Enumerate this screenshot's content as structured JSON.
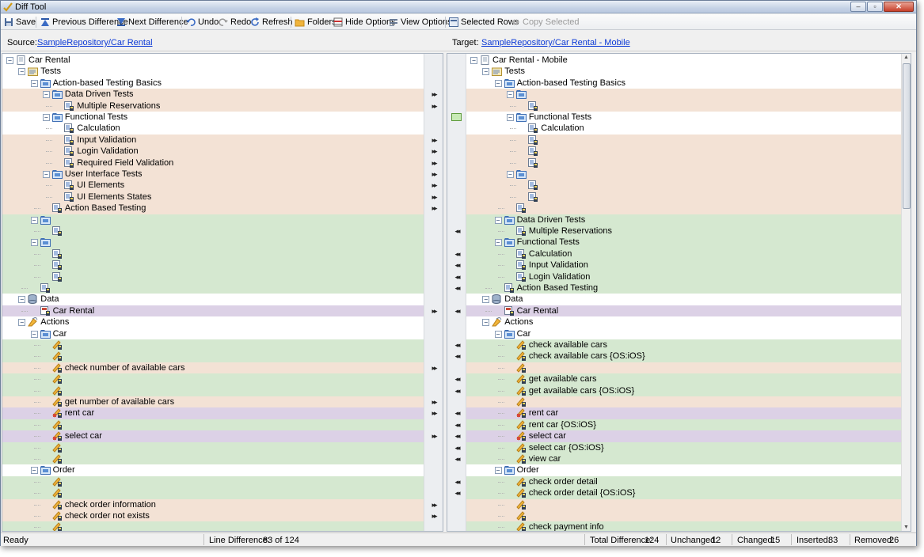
{
  "window": {
    "title": "Diff Tool",
    "controls": {
      "minimize": "–",
      "maximize": "▫",
      "close": "✕"
    }
  },
  "toolbar": {
    "save": "Save",
    "previous_difference": "Previous Difference",
    "next_difference": "Next Difference",
    "undo": "Undo",
    "redo": "Redo",
    "refresh": "Refresh",
    "folders": "Folders",
    "hide_options": "Hide Options",
    "view_options": "View Options",
    "selected_rows": "Selected Rows",
    "copy_selected": "Copy Selected"
  },
  "source": {
    "label": "Source:",
    "path": "SampleRepository/Car Rental"
  },
  "target": {
    "label": "Target:",
    "path": "SampleRepository/Car Rental - Mobile"
  },
  "icon_legend": {
    "project": "document-icon",
    "tests": "tests-folder-icon",
    "folder": "folder-icon",
    "module": "test-module-icon",
    "data": "database-icon",
    "dataset": "dataset-icon",
    "actions": "actions-icon",
    "action": "action-icon",
    "action_lib": "action-library-icon"
  },
  "colors": {
    "changed": "#f3e2d5",
    "inserted": "#d5e8d0",
    "modified": "#dcd1e6",
    "link": "#0d3ad6"
  },
  "left_rows": [
    {
      "label": "Car Rental",
      "icon": "project",
      "depth": 0,
      "state": "none",
      "exp": "-"
    },
    {
      "label": "Tests",
      "icon": "tests",
      "depth": 1,
      "state": "none",
      "exp": "-"
    },
    {
      "label": "Action-based Testing Basics",
      "icon": "folder",
      "depth": 2,
      "state": "none",
      "exp": "-"
    },
    {
      "label": "Data Driven Tests",
      "icon": "folder",
      "depth": 3,
      "state": "changed",
      "exp": "-",
      "arrow": "right"
    },
    {
      "label": "Multiple Reservations",
      "icon": "module",
      "depth": 4,
      "state": "changed",
      "arrow": "right"
    },
    {
      "label": "Functional Tests",
      "icon": "folder",
      "depth": 3,
      "state": "none",
      "exp": "-"
    },
    {
      "label": "Calculation",
      "icon": "module",
      "depth": 4,
      "state": "none"
    },
    {
      "label": "Input Validation",
      "icon": "module",
      "depth": 4,
      "state": "changed",
      "arrow": "right"
    },
    {
      "label": "Login Validation",
      "icon": "module",
      "depth": 4,
      "state": "changed",
      "arrow": "right"
    },
    {
      "label": "Required Field Validation",
      "icon": "module",
      "depth": 4,
      "state": "changed",
      "arrow": "right"
    },
    {
      "label": "User Interface Tests",
      "icon": "folder",
      "depth": 3,
      "state": "changed",
      "exp": "-",
      "arrow": "right"
    },
    {
      "label": "UI Elements",
      "icon": "module",
      "depth": 4,
      "state": "changed",
      "arrow": "right"
    },
    {
      "label": "UI Elements States",
      "icon": "module",
      "depth": 4,
      "state": "changed",
      "arrow": "right"
    },
    {
      "label": "Action Based Testing",
      "icon": "module",
      "depth": 3,
      "state": "changed",
      "arrow": "right"
    },
    {
      "label": "",
      "icon": "folder",
      "depth": 2,
      "state": "inserted",
      "exp": "-"
    },
    {
      "label": "",
      "icon": "module",
      "depth": 3,
      "state": "inserted"
    },
    {
      "label": "",
      "icon": "folder",
      "depth": 2,
      "state": "inserted",
      "exp": "-"
    },
    {
      "label": "",
      "icon": "module",
      "depth": 3,
      "state": "inserted"
    },
    {
      "label": "",
      "icon": "module",
      "depth": 3,
      "state": "inserted"
    },
    {
      "label": "",
      "icon": "module",
      "depth": 3,
      "state": "inserted"
    },
    {
      "label": "",
      "icon": "module",
      "depth": 2,
      "state": "inserted"
    },
    {
      "label": "Data",
      "icon": "data",
      "depth": 1,
      "state": "none",
      "exp": "-"
    },
    {
      "label": "Car Rental",
      "icon": "dataset",
      "depth": 2,
      "state": "modified",
      "arrow": "right"
    },
    {
      "label": "Actions",
      "icon": "actions",
      "depth": 1,
      "state": "none",
      "exp": "-"
    },
    {
      "label": "Car",
      "icon": "folder",
      "depth": 2,
      "state": "none",
      "exp": "-"
    },
    {
      "label": "",
      "icon": "action",
      "depth": 3,
      "state": "inserted"
    },
    {
      "label": "",
      "icon": "action",
      "depth": 3,
      "state": "inserted"
    },
    {
      "label": "check number of available cars",
      "icon": "action",
      "depth": 3,
      "state": "changed",
      "arrow": "right"
    },
    {
      "label": "",
      "icon": "action",
      "depth": 3,
      "state": "inserted"
    },
    {
      "label": "",
      "icon": "action",
      "depth": 3,
      "state": "inserted"
    },
    {
      "label": "get number of available cars",
      "icon": "action",
      "depth": 3,
      "state": "changed",
      "arrow": "right"
    },
    {
      "label": "rent car",
      "icon": "action_lib",
      "depth": 3,
      "state": "modified",
      "arrow": "right"
    },
    {
      "label": "",
      "icon": "action",
      "depth": 3,
      "state": "inserted"
    },
    {
      "label": "select car",
      "icon": "action_lib",
      "depth": 3,
      "state": "modified",
      "arrow": "right"
    },
    {
      "label": "",
      "icon": "action",
      "depth": 3,
      "state": "inserted"
    },
    {
      "label": "",
      "icon": "action",
      "depth": 3,
      "state": "inserted"
    },
    {
      "label": "Order",
      "icon": "folder",
      "depth": 2,
      "state": "none",
      "exp": "-"
    },
    {
      "label": "",
      "icon": "action",
      "depth": 3,
      "state": "inserted"
    },
    {
      "label": "",
      "icon": "action",
      "depth": 3,
      "state": "inserted"
    },
    {
      "label": "check order information",
      "icon": "action",
      "depth": 3,
      "state": "changed",
      "arrow": "right"
    },
    {
      "label": "check order not exists",
      "icon": "action",
      "depth": 3,
      "state": "changed",
      "arrow": "right"
    },
    {
      "label": "",
      "icon": "action",
      "depth": 3,
      "state": "inserted"
    }
  ],
  "right_rows": [
    {
      "label": "Car Rental - Mobile",
      "icon": "project",
      "depth": 0,
      "state": "none",
      "exp": "-"
    },
    {
      "label": "Tests",
      "icon": "tests",
      "depth": 1,
      "state": "none",
      "exp": "-"
    },
    {
      "label": "Action-based Testing Basics",
      "icon": "folder",
      "depth": 2,
      "state": "none",
      "exp": "-"
    },
    {
      "label": "",
      "icon": "folder",
      "depth": 3,
      "state": "changed",
      "exp": "-"
    },
    {
      "label": "",
      "icon": "module",
      "depth": 4,
      "state": "changed"
    },
    {
      "label": "Functional Tests",
      "icon": "folder",
      "depth": 3,
      "state": "none",
      "exp": "-",
      "copy": true
    },
    {
      "label": "Calculation",
      "icon": "module",
      "depth": 4,
      "state": "none"
    },
    {
      "label": "",
      "icon": "module",
      "depth": 4,
      "state": "changed"
    },
    {
      "label": "",
      "icon": "module",
      "depth": 4,
      "state": "changed"
    },
    {
      "label": "",
      "icon": "module",
      "depth": 4,
      "state": "changed"
    },
    {
      "label": "",
      "icon": "folder",
      "depth": 3,
      "state": "changed",
      "exp": "-"
    },
    {
      "label": "",
      "icon": "module",
      "depth": 4,
      "state": "changed"
    },
    {
      "label": "",
      "icon": "module",
      "depth": 4,
      "state": "changed"
    },
    {
      "label": "",
      "icon": "module",
      "depth": 3,
      "state": "changed"
    },
    {
      "label": "Data Driven Tests",
      "icon": "folder",
      "depth": 2,
      "state": "inserted",
      "exp": "-"
    },
    {
      "label": "Multiple Reservations",
      "icon": "module",
      "depth": 3,
      "state": "inserted",
      "arrow": "left"
    },
    {
      "label": "Functional Tests",
      "icon": "folder",
      "depth": 2,
      "state": "inserted",
      "exp": "-"
    },
    {
      "label": "Calculation",
      "icon": "module",
      "depth": 3,
      "state": "inserted",
      "arrow": "left"
    },
    {
      "label": "Input Validation",
      "icon": "module",
      "depth": 3,
      "state": "inserted",
      "arrow": "left"
    },
    {
      "label": "Login Validation",
      "icon": "module",
      "depth": 3,
      "state": "inserted",
      "arrow": "left"
    },
    {
      "label": "Action Based Testing",
      "icon": "module",
      "depth": 2,
      "state": "inserted",
      "arrow": "left"
    },
    {
      "label": "Data",
      "icon": "data",
      "depth": 1,
      "state": "none",
      "exp": "-"
    },
    {
      "label": "Car Rental",
      "icon": "dataset",
      "depth": 2,
      "state": "modified",
      "arrow": "left"
    },
    {
      "label": "Actions",
      "icon": "actions",
      "depth": 1,
      "state": "none",
      "exp": "-"
    },
    {
      "label": "Car",
      "icon": "folder",
      "depth": 2,
      "state": "none",
      "exp": "-"
    },
    {
      "label": "check available cars",
      "icon": "action",
      "depth": 3,
      "state": "inserted",
      "arrow": "left"
    },
    {
      "label": "check available cars {OS:iOS}",
      "icon": "action",
      "depth": 3,
      "state": "inserted",
      "arrow": "left"
    },
    {
      "label": "",
      "icon": "action",
      "depth": 3,
      "state": "changed"
    },
    {
      "label": "get available cars",
      "icon": "action",
      "depth": 3,
      "state": "inserted",
      "arrow": "left"
    },
    {
      "label": "get available cars {OS:iOS}",
      "icon": "action",
      "depth": 3,
      "state": "inserted",
      "arrow": "left"
    },
    {
      "label": "",
      "icon": "action",
      "depth": 3,
      "state": "changed"
    },
    {
      "label": "rent car",
      "icon": "action_lib",
      "depth": 3,
      "state": "modified",
      "arrow": "left"
    },
    {
      "label": "rent car {OS:iOS}",
      "icon": "action",
      "depth": 3,
      "state": "inserted",
      "arrow": "left"
    },
    {
      "label": "select car",
      "icon": "action_lib",
      "depth": 3,
      "state": "modified",
      "arrow": "left"
    },
    {
      "label": "select car {OS:iOS}",
      "icon": "action",
      "depth": 3,
      "state": "inserted",
      "arrow": "left"
    },
    {
      "label": "view car",
      "icon": "action",
      "depth": 3,
      "state": "inserted",
      "arrow": "left"
    },
    {
      "label": "Order",
      "icon": "folder",
      "depth": 2,
      "state": "none",
      "exp": "-"
    },
    {
      "label": "check order detail",
      "icon": "action",
      "depth": 3,
      "state": "inserted",
      "arrow": "left"
    },
    {
      "label": "check order detail {OS:iOS}",
      "icon": "action",
      "depth": 3,
      "state": "inserted",
      "arrow": "left"
    },
    {
      "label": "",
      "icon": "action",
      "depth": 3,
      "state": "changed"
    },
    {
      "label": "",
      "icon": "action",
      "depth": 3,
      "state": "changed"
    },
    {
      "label": "check payment info",
      "icon": "action",
      "depth": 3,
      "state": "inserted"
    }
  ],
  "status": {
    "ready": "Ready",
    "line_difference_label": "Line Difference:",
    "line_difference_value": "83 of 124",
    "total_difference_label": "Total Difference:",
    "total_difference_value": "124",
    "unchanged_label": "Unchanged:",
    "unchanged_value": "12",
    "changed_label": "Changed:",
    "changed_value": "15",
    "inserted_label": "Inserted:",
    "inserted_value": "83",
    "removed_label": "Removed:",
    "removed_value": "26"
  }
}
